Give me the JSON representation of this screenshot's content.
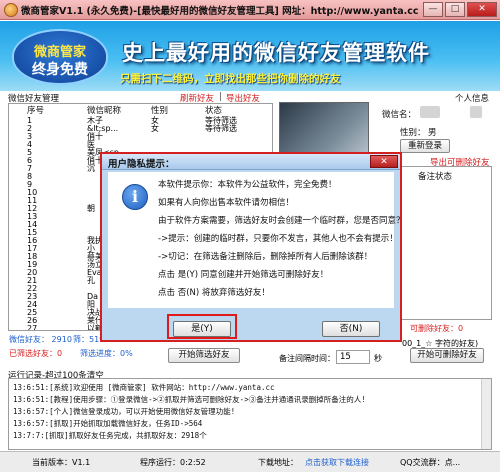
{
  "window": {
    "title": "微商管家V1.1 (永久免费)-[最快最好用的微信好友管理工具]   网址：http://www.yanta.cc",
    "minimize": "—",
    "maximize": "□",
    "close": "✕"
  },
  "banner": {
    "badge_line1": "微商管家",
    "badge_line2": "终身免费",
    "slogan": "史上最好用的微信好友管理软件",
    "subslogan": "只需扫下二维码，立即找出那些把你删除的好友"
  },
  "friends_section": {
    "title": "微信好友管理",
    "refresh_link": "刷新好友",
    "separator": "|",
    "export_link": "导出好友",
    "headers": [
      "序号",
      "微信昵称",
      "性别",
      "状态"
    ],
    "rows": [
      {
        "no": "1",
        "name": "木子",
        "gender": "女",
        "status": "等待筛选"
      },
      {
        "no": "2",
        "name": "&lt;sp...",
        "gender": "女",
        "status": "等待筛选"
      },
      {
        "no": "3",
        "name": "俏十",
        "gender": "",
        "status": ""
      },
      {
        "no": "4",
        "name": "医",
        "gender": "",
        "status": ""
      },
      {
        "no": "5",
        "name": "美凤<sp",
        "gender": "",
        "status": ""
      },
      {
        "no": "6",
        "name": "俏十",
        "gender": "",
        "status": ""
      },
      {
        "no": "7",
        "name": "沉",
        "gender": "",
        "status": ""
      },
      {
        "no": "8",
        "name": "",
        "gender": "",
        "status": ""
      },
      {
        "no": "9",
        "name": "",
        "gender": "",
        "status": ""
      },
      {
        "no": "10",
        "name": "",
        "gender": "",
        "status": ""
      },
      {
        "no": "11",
        "name": "",
        "gender": "",
        "status": ""
      },
      {
        "no": "12",
        "name": "朝",
        "gender": "",
        "status": ""
      },
      {
        "no": "13",
        "name": "",
        "gender": "",
        "status": ""
      },
      {
        "no": "14",
        "name": "",
        "gender": "",
        "status": ""
      },
      {
        "no": "15",
        "name": "",
        "gender": "",
        "status": ""
      },
      {
        "no": "16",
        "name": "我执美",
        "gender": "",
        "status": ""
      },
      {
        "no": "17",
        "name": "小",
        "gender": "",
        "status": ""
      },
      {
        "no": "18",
        "name": "蔡美人",
        "gender": "",
        "status": ""
      },
      {
        "no": "19",
        "name": "汤立东",
        "gender": "",
        "status": ""
      },
      {
        "no": "20",
        "name": "Eva",
        "gender": "",
        "status": ""
      },
      {
        "no": "21",
        "name": "孔",
        "gender": "",
        "status": ""
      },
      {
        "no": "22",
        "name": "",
        "gender": "",
        "status": ""
      },
      {
        "no": "23",
        "name": "Da",
        "gender": "",
        "status": ""
      },
      {
        "no": "24",
        "name": "阳",
        "gender": "",
        "status": ""
      },
      {
        "no": "25",
        "name": "决战",
        "gender": "",
        "status": ""
      },
      {
        "no": "26",
        "name": "莱什",
        "gender": "",
        "status": ""
      },
      {
        "no": "27",
        "name": "以鹤",
        "gender": "",
        "status": ""
      }
    ]
  },
  "profile": {
    "title": "个人信息",
    "nickname_label": "微信名：",
    "gender_label": "性别：",
    "gender_value": "男",
    "relogin_button": "重新登录"
  },
  "deletable": {
    "title": "导出可删除好友",
    "status_header": "备注状态"
  },
  "stats": {
    "friend_count_label": "微信好友：",
    "friend_count": "2910",
    "rows_label": "筛：519",
    "screened_label": "已筛选好友：0",
    "progress_label": "筛选进度：0%",
    "progress_value": 0,
    "deletable_count": "可删除好友：0",
    "note_hint": "00_1_☆ 字符的好友)"
  },
  "controls": {
    "start_button": "开始筛选好友",
    "interval_label": "备注间隔时间：",
    "interval_value": "15",
    "interval_unit": "秒",
    "remark_button": "开始可删除好友"
  },
  "log": {
    "title": "运行记录-超过100条清空",
    "lines": [
      "13:6:51:[系统]欢迎使用 [微商管家]  软件网站：http://www.yanta.cc",
      "13:6:51:[教程]使用步骤：①登录微信->②抓取并筛选可删除好友->③备注并通通讯录删掉所备注的人!",
      "13:6:57:[个人]微信登录成功，可以开始使用微信好友管理功能!",
      "13:6:57:[抓取]开始抓取加载微信好友，任务ID->564",
      "13:7:7:[抓取]抓取好友任务完成，共抓取好友：2918个"
    ]
  },
  "statusbar": {
    "version": "当前版本：V1.1",
    "runtime": "程序运行：0:2:52",
    "download_label": "下载地址：",
    "download_link": "点击获取下载连接",
    "qq_group": "QQ交流群：点..."
  },
  "dialog": {
    "title": "用户隐私提示：",
    "close": "✕",
    "icon": "i",
    "messages": [
      "本软件提示你：本软件为公益软件，完全免费！",
      "如果有人向你出售本软件请勿相信！",
      "由于软件方案需要，筛选好友时会创建一个临时群，您是否同意？",
      "->提示：创建的临时群，只要你不发言，其他人也不会有提示！",
      "->切记：在筛选备注删除后，删除掉所有人后删除该群！",
      "点击 是(Y) 同意创建并开始筛选可删除好友！",
      "点击 否(N) 将放弃筛选好友！"
    ],
    "yes_button": "是(Y)",
    "no_button": "否(N)"
  }
}
